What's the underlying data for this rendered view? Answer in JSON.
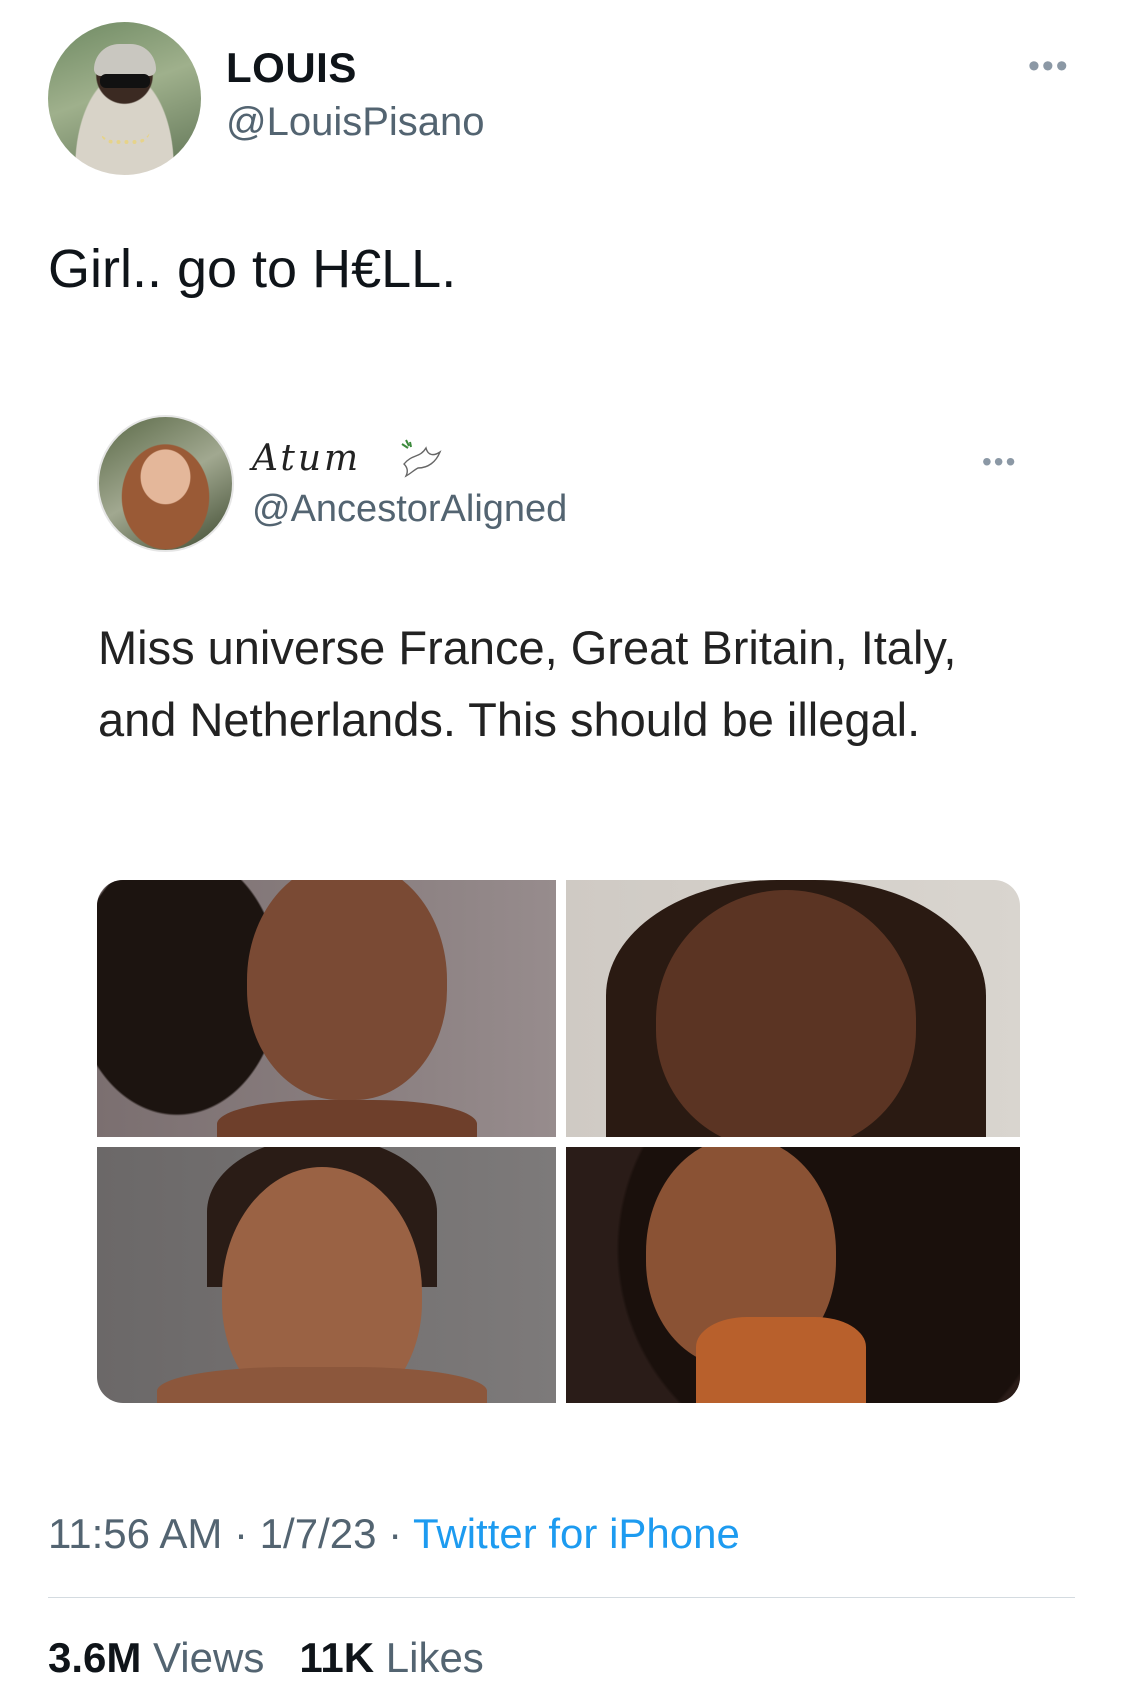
{
  "tweet": {
    "author_name": "LOUIS",
    "author_handle": "@LouisPisano",
    "text": "Girl.. go to H€LL.",
    "more_icon": "more-horizontal-icon",
    "time": "11:56 AM",
    "date": "1/7/23",
    "source": "Twitter for iPhone",
    "separator": " · ",
    "views_count": "3.6M",
    "views_label": "Views",
    "likes_count": "11K",
    "likes_label": "Likes"
  },
  "quoted": {
    "author_name": "Atum",
    "author_handle": "@AncestorAligned",
    "name_icon": "dove-icon",
    "text": "Miss universe France, Great Britain, Italy, and Netherlands. This should be illegal.",
    "more_icon": "more-horizontal-icon",
    "photos": [
      "portrait-photo",
      "portrait-photo",
      "portrait-photo",
      "portrait-photo"
    ]
  },
  "colors": {
    "link": "#1d9bf0",
    "secondary_text": "#536471",
    "primary_text": "#0f1419"
  }
}
